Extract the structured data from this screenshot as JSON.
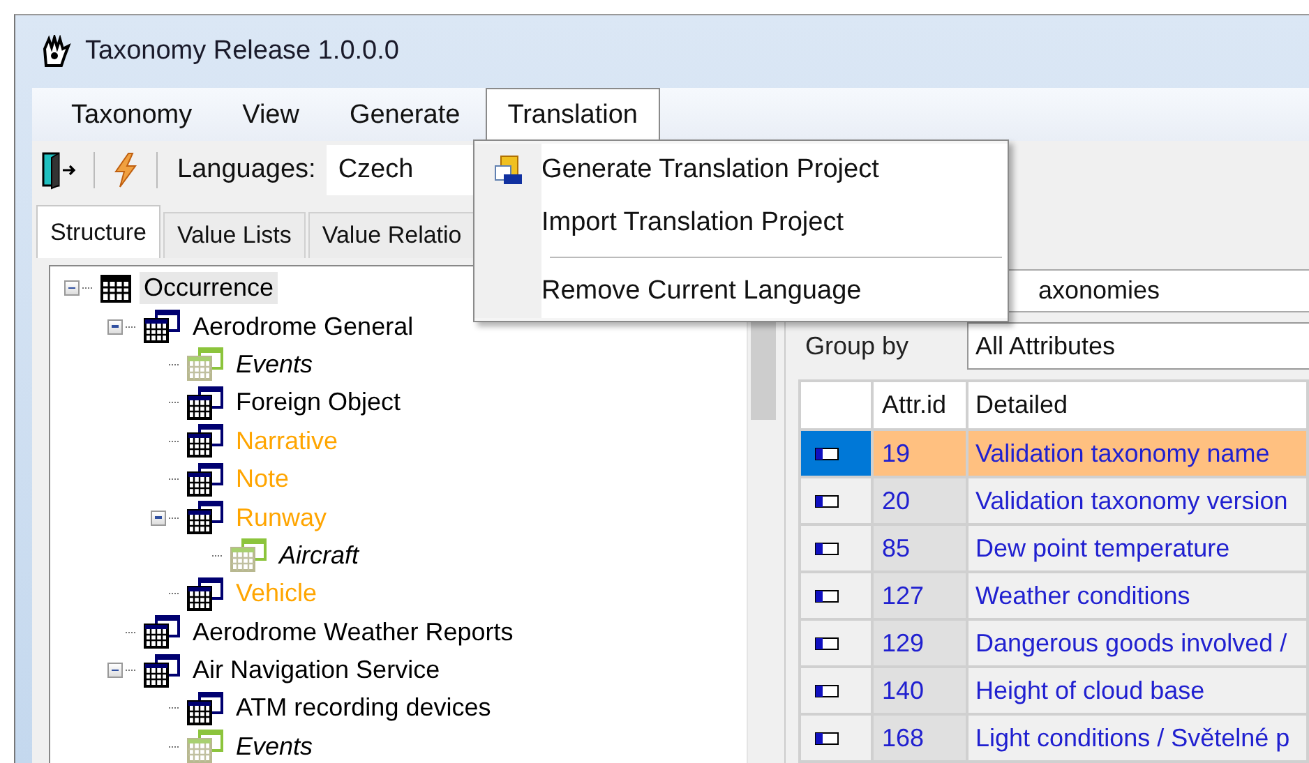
{
  "window": {
    "title": "Taxonomy Release 1.0.0.0"
  },
  "menu_bar": [
    {
      "label": "Taxonomy",
      "selected": false
    },
    {
      "label": "View",
      "selected": false
    },
    {
      "label": "Generate",
      "selected": false
    },
    {
      "label": "Translation",
      "selected": true
    }
  ],
  "translation_menu": [
    {
      "kind": "item",
      "label": "Generate Translation Project",
      "has_icon": true
    },
    {
      "kind": "item",
      "label": "Import Translation Project",
      "has_icon": false
    },
    {
      "kind": "separator"
    },
    {
      "kind": "item",
      "label": "Remove Current Language",
      "has_icon": false
    }
  ],
  "toolbar": {
    "language_label": "Languages:",
    "language": "Czech"
  },
  "tabs": [
    {
      "label": "Structure",
      "selected": true
    },
    {
      "label": "Value Lists",
      "selected": false
    },
    {
      "label": "Value Relatio",
      "selected": false
    }
  ],
  "tree": [
    {
      "label": "Occurrence",
      "kind": "root",
      "color": "#000000",
      "selected": true,
      "expanded": true,
      "children": [
        {
          "label": "Aerodrome General",
          "kind": "table",
          "color": "#000000",
          "selected": false,
          "expanded": true,
          "children": [
            {
              "label": "Events",
              "kind": "link",
              "color": "#000000",
              "selected": false
            },
            {
              "label": "Foreign Object",
              "kind": "table",
              "color": "#000000",
              "selected": false
            },
            {
              "label": "Narrative",
              "kind": "table",
              "color": "#ffa500",
              "selected": false
            },
            {
              "label": "Note",
              "kind": "table",
              "color": "#ffa500",
              "selected": false
            },
            {
              "label": "Runway",
              "kind": "table",
              "color": "#ffa500",
              "selected": false,
              "expanded": true,
              "children": [
                {
                  "label": "Aircraft",
                  "kind": "link",
                  "color": "#000000",
                  "selected": false
                }
              ]
            },
            {
              "label": "Vehicle",
              "kind": "table",
              "color": "#ffa500",
              "selected": false
            }
          ]
        },
        {
          "label": "Aerodrome Weather Reports",
          "kind": "table",
          "color": "#000000",
          "selected": false
        },
        {
          "label": "Air Navigation Service",
          "kind": "table",
          "color": "#000000",
          "selected": false,
          "expanded": true,
          "children": [
            {
              "label": "ATM recording devices",
              "kind": "table",
              "color": "#000000",
              "selected": false
            },
            {
              "label": "Events",
              "kind": "link",
              "color": "#000000",
              "selected": false
            }
          ]
        }
      ]
    }
  ],
  "right_panel": {
    "taxonomy_field": "axonomies",
    "group_by_label": "Group by",
    "group_by": "All Attributes"
  },
  "grid": {
    "columns": [
      "Attr.id",
      "Detailed"
    ],
    "rows": [
      {
        "id": "19",
        "detailed": "Validation taxonomy name",
        "selected": true
      },
      {
        "id": "20",
        "detailed": "Validation taxonomy version",
        "selected": false
      },
      {
        "id": "85",
        "detailed": "Dew point temperature",
        "selected": false
      },
      {
        "id": "127",
        "detailed": "Weather conditions",
        "selected": false
      },
      {
        "id": "129",
        "detailed": "Dangerous goods involved /",
        "selected": false
      },
      {
        "id": "140",
        "detailed": "Height of cloud base",
        "selected": false
      },
      {
        "id": "168",
        "detailed": "Light conditions / Světelné p",
        "selected": false
      }
    ]
  }
}
